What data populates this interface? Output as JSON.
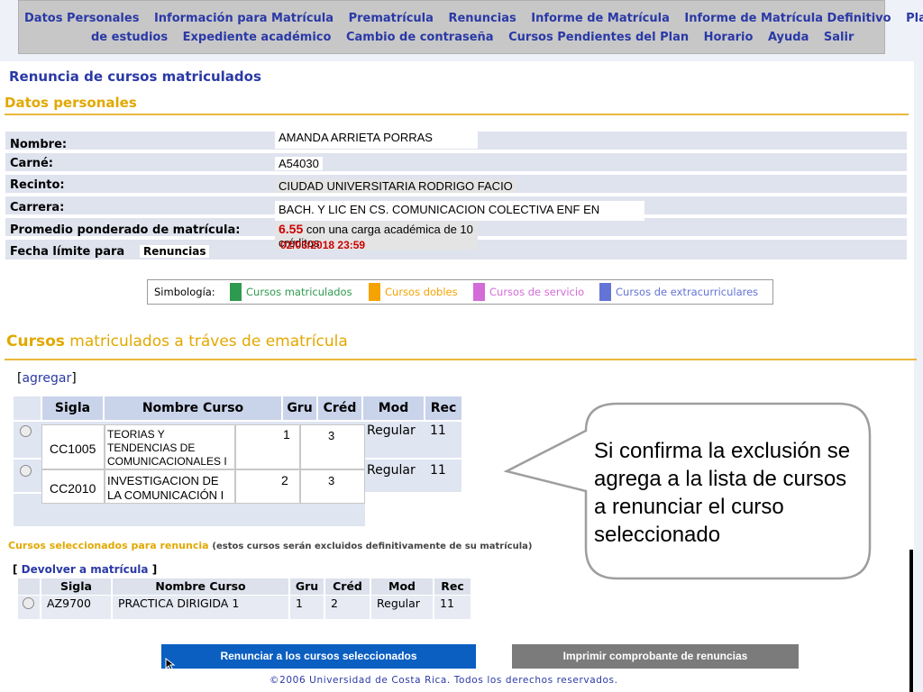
{
  "nav": {
    "row1": [
      "Datos Personales",
      "Información para Matrícula",
      "Prematrícula",
      "Renuncias",
      "Informe de Matrícula",
      "Informe de Matrícula Definitivo",
      "Plan"
    ],
    "row2": [
      "de estudios",
      "Expediente académico",
      "Cambio de contraseña",
      "Cursos Pendientes del Plan",
      "Horario",
      "Ayuda",
      "Salir"
    ]
  },
  "page_title": "Renuncia de cursos matriculados",
  "personal": {
    "heading": "Datos personales",
    "labels": {
      "nombre": "Nombre:",
      "carne": "Carné:",
      "recinto": "Recinto:",
      "carrera": "Carrera:",
      "promedio": "Promedio ponderado de matrícula:",
      "fecha": "Fecha límite para"
    },
    "nombre": "AMANDA ARRIETA PORRAS",
    "carne": "A54030",
    "recinto": "CIUDAD UNIVERSITARIA RODRIGO FACIO",
    "carrera": "BACH. Y LIC EN CS. COMUNICACION COLECTIVA ENF EN",
    "promedio_valor": "6.55",
    "promedio_texto": "con una carga académica de 10 créditos",
    "fecha_tipo": "Renuncias",
    "fecha_limite": "02/03/2018  23:59"
  },
  "legend": {
    "label": "Simbología:",
    "items": [
      {
        "text": "Cursos matriculados",
        "color": "#2e9a4f"
      },
      {
        "text": "Cursos dobles",
        "color": "#f5a300"
      },
      {
        "text": "Cursos de servicio",
        "color": "#d36bd8"
      },
      {
        "text": "Cursos de extracurriculares",
        "color": "#6373d6"
      }
    ]
  },
  "cursos": {
    "heading_bold": "Cursos",
    "heading_rest": "matriculados  a tráves de ematrícula",
    "agregar": "agregar",
    "headers": [
      "Sigla",
      "Nombre Curso",
      "Gru",
      "Créd",
      "Mod",
      "Rec"
    ],
    "rows": [
      {
        "sigla": "CC1005",
        "nombre": "TEORIAS Y TENDENCIAS DE COMUNICACIONALES I",
        "gru": "1",
        "cred": "3",
        "mod": "Regular",
        "rec": "11"
      },
      {
        "sigla": "CC2010",
        "nombre": "INVESTIGACION DE LA COMUNICACIÓN I",
        "gru": "2",
        "cred": "3",
        "mod": "Regular",
        "rec": "11"
      }
    ]
  },
  "callout": "Si confirma la exclusión se agrega a la lista de cursos a renunciar el curso seleccionado",
  "seleccionados": {
    "heading": "Cursos seleccionados para renuncia",
    "note": "(estos cursos serán excluidos definitivamente de su matrícula)",
    "devolver": "Devolver a matrícula",
    "headers": [
      "Sigla",
      "Nombre Curso",
      "Gru",
      "Créd",
      "Mod",
      "Rec"
    ],
    "rows": [
      {
        "sigla": "AZ9700",
        "nombre": "PRACTICA DIRIGIDA 1",
        "gru": "1",
        "cred": "2",
        "mod": "Regular",
        "rec": "11"
      }
    ]
  },
  "buttons": {
    "renunciar": "Renunciar a los cursos seleccionados",
    "imprimir": "Imprimir comprobante de renuncias"
  },
  "footer": "©2006 Universidad de Costa Rica. Todos los derechos reservados.",
  "colors": {
    "nav_text": "#2a39a6",
    "accent_orange": "#e2a800",
    "button_blue": "#0a5fc1",
    "button_gray": "#7b7b7b",
    "alert_red": "#cc0000"
  }
}
